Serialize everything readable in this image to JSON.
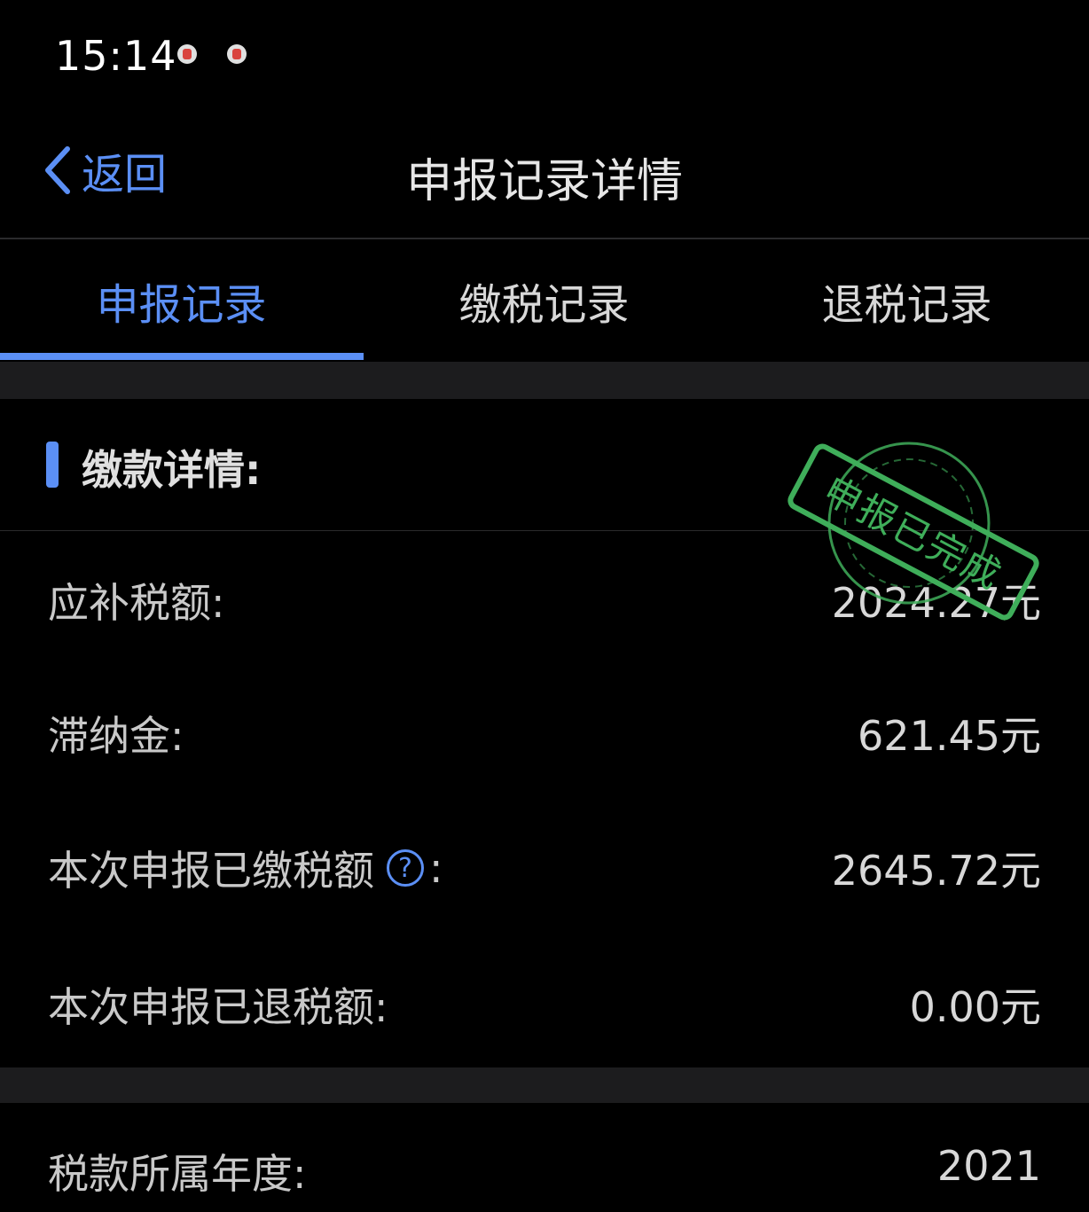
{
  "status": {
    "time": "15:14"
  },
  "nav": {
    "back_label": "返回",
    "title": "申报记录详情"
  },
  "tabs": [
    {
      "label": "申报记录",
      "active": true
    },
    {
      "label": "缴税记录",
      "active": false
    },
    {
      "label": "退税记录",
      "active": false
    }
  ],
  "section": {
    "title": "缴款详情:"
  },
  "stamp": {
    "text": "申报已完成",
    "color": "#3fae5a"
  },
  "rows": [
    {
      "label": "应补税额:",
      "value": "2024.27元"
    },
    {
      "label": "滞纳金:",
      "value": "621.45元"
    },
    {
      "label": "本次申报已缴税额",
      "suffix": ":",
      "value": "2645.72元"
    },
    {
      "label": "本次申报已退税额:",
      "value": "0.00元"
    }
  ],
  "footer_row": {
    "label": "税款所属年度:",
    "value": "2021"
  },
  "colors": {
    "accent": "#5b8ff5",
    "background": "#000000",
    "divider": "#1c1c1e"
  }
}
